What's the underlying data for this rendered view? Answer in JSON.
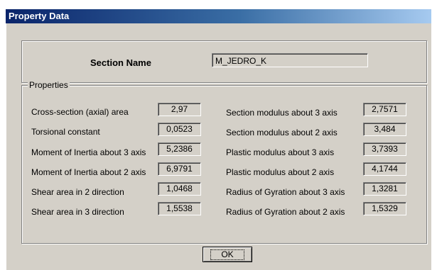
{
  "window": {
    "title": "Property Data"
  },
  "section": {
    "label": "Section Name",
    "value": "M_JEDRO_K"
  },
  "properties": {
    "legend": "Properties",
    "left": [
      {
        "label": "Cross-section (axial) area",
        "value": "2,97"
      },
      {
        "label": "Torsional constant",
        "value": "0,0523"
      },
      {
        "label": "Moment of Inertia about 3 axis",
        "value": "5,2386"
      },
      {
        "label": "Moment of Inertia about 2 axis",
        "value": "6,9791"
      },
      {
        "label": "Shear area in 2 direction",
        "value": "1,0468"
      },
      {
        "label": "Shear area in 3 direction",
        "value": "1,5538"
      }
    ],
    "right": [
      {
        "label": "Section modulus about 3 axis",
        "value": "2,7571"
      },
      {
        "label": "Section modulus about 2 axis",
        "value": "3,484"
      },
      {
        "label": "Plastic modulus about 3 axis",
        "value": "3,7393"
      },
      {
        "label": "Plastic modulus about 2 axis",
        "value": "4,1744"
      },
      {
        "label": "Radius of Gyration about 3 axis",
        "value": "1,3281"
      },
      {
        "label": "Radius of Gyration about 2 axis",
        "value": "1,5329"
      }
    ]
  },
  "buttons": {
    "ok_label": "OK"
  }
}
